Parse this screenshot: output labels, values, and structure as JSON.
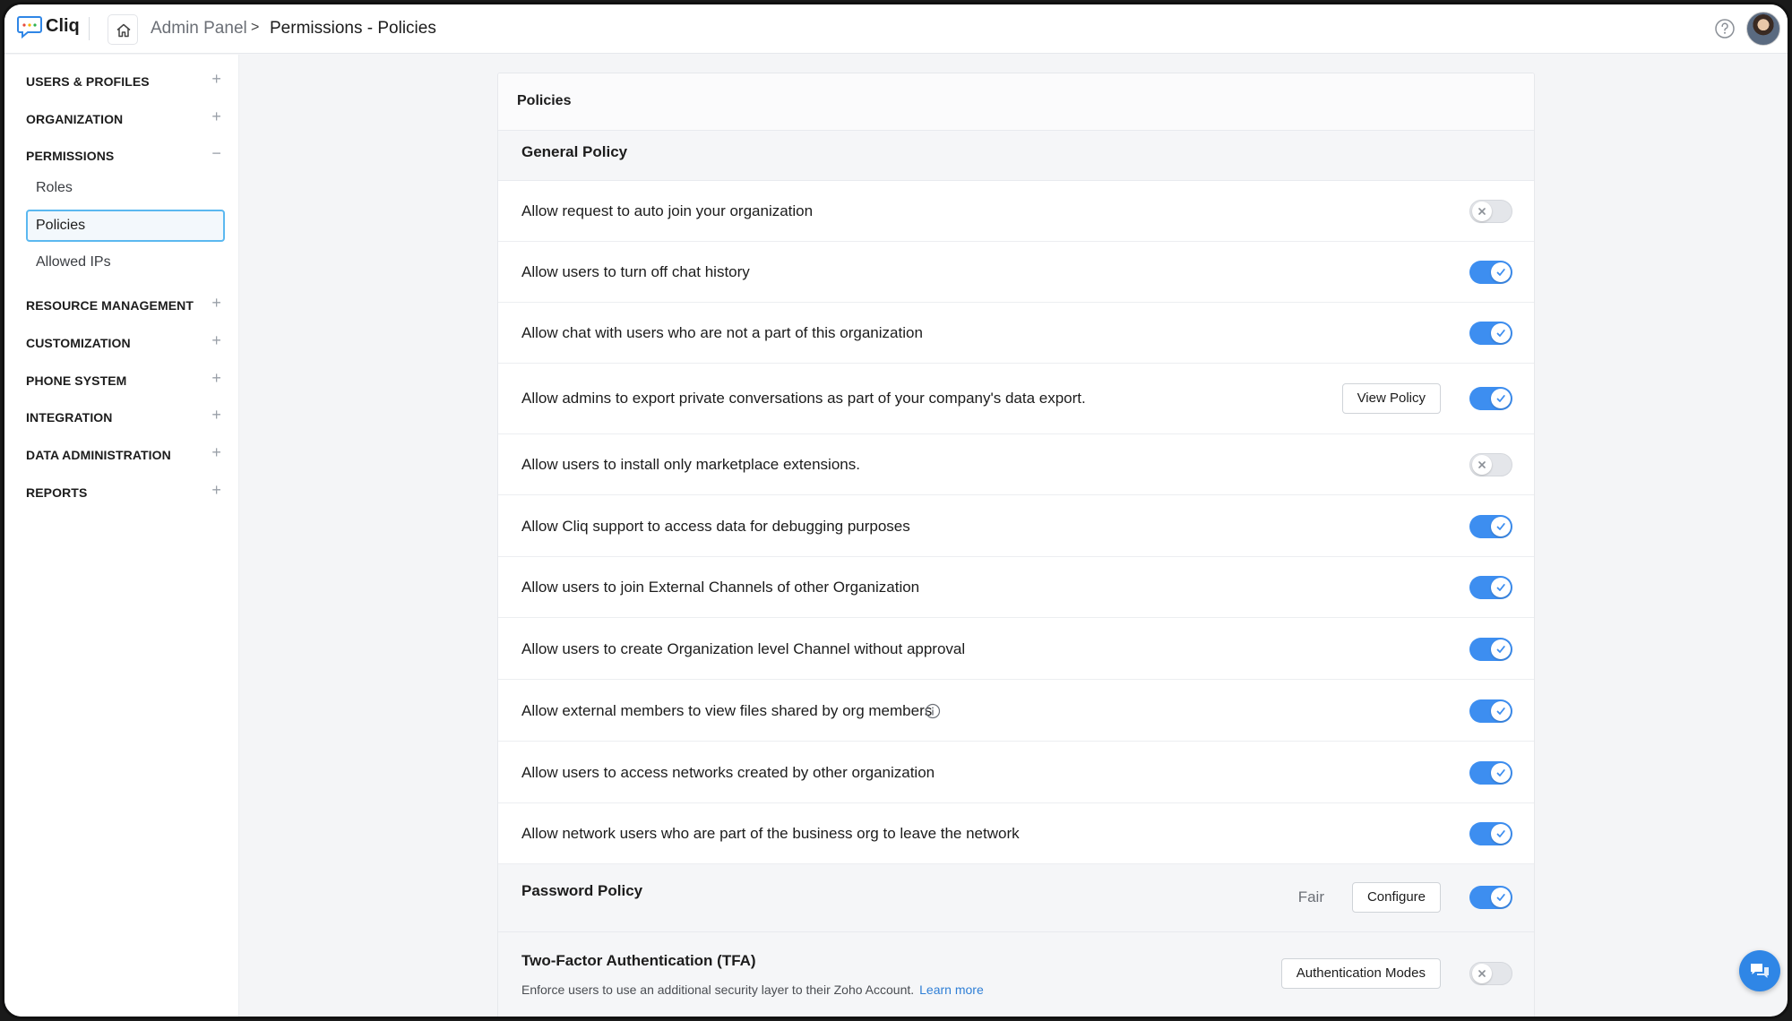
{
  "app": {
    "name": "Cliq"
  },
  "breadcrumb": {
    "root": "Admin Panel",
    "separator": ">",
    "current": "Permissions - Policies"
  },
  "sidebar": {
    "sections": [
      {
        "label": "USERS & PROFILES",
        "expander": "+"
      },
      {
        "label": "ORGANIZATION",
        "expander": "+"
      },
      {
        "label": "PERMISSIONS",
        "expander": "−"
      },
      {
        "label": "RESOURCE MANAGEMENT",
        "expander": "+"
      },
      {
        "label": "CUSTOMIZATION",
        "expander": "+"
      },
      {
        "label": "PHONE SYSTEM",
        "expander": "+"
      },
      {
        "label": "INTEGRATION",
        "expander": "+"
      },
      {
        "label": "DATA ADMINISTRATION",
        "expander": "+"
      },
      {
        "label": "REPORTS",
        "expander": "+"
      }
    ],
    "permissions_items": [
      {
        "label": "Roles",
        "active": false
      },
      {
        "label": "Policies",
        "active": true
      },
      {
        "label": "Allowed IPs",
        "active": false
      }
    ]
  },
  "card": {
    "title": "Policies",
    "general_policy": {
      "title": "General Policy",
      "rows": [
        {
          "text": "Allow request to auto join your organization",
          "enabled": false
        },
        {
          "text": "Allow users to turn off chat history",
          "enabled": true
        },
        {
          "text": "Allow chat with users who are not a part of this organization",
          "enabled": true
        },
        {
          "text": "Allow admins to export private conversations as part of your company's data export.",
          "enabled": true,
          "button": "View Policy"
        },
        {
          "text": "Allow users to install only marketplace extensions.",
          "enabled": false
        },
        {
          "text": "Allow Cliq support to access data for debugging purposes",
          "enabled": true
        },
        {
          "text": "Allow users to join External Channels of other Organization",
          "enabled": true
        },
        {
          "text": "Allow users to create Organization level Channel without approval",
          "enabled": true
        },
        {
          "text": "Allow external members to view files shared by org members",
          "enabled": true,
          "info": true
        },
        {
          "text": "Allow users to access networks created by other organization",
          "enabled": true
        },
        {
          "text": "Allow network users who are part of the business org to leave the network",
          "enabled": true
        }
      ]
    },
    "password_policy": {
      "title": "Password Policy",
      "strength": "Fair",
      "button": "Configure",
      "enabled": true
    },
    "tfa": {
      "title": "Two-Factor Authentication (TFA)",
      "description": "Enforce users to use an additional security layer to their Zoho Account.",
      "link": "Learn more",
      "button": "Authentication Modes",
      "enabled": false
    }
  },
  "colors": {
    "accent": "#3d8ef0",
    "active_border": "#5bb8f0",
    "link": "#2f7fd6"
  }
}
